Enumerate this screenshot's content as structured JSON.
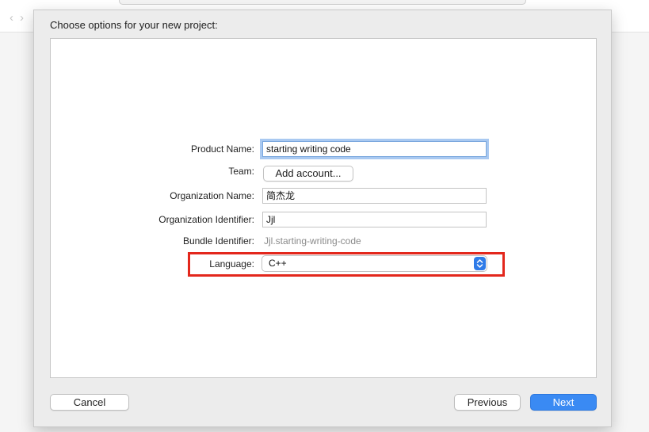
{
  "dialog": {
    "title": "Choose options for your new project:"
  },
  "form": {
    "product_name": {
      "label": "Product Name:",
      "value": "starting writing code"
    },
    "team": {
      "label": "Team:",
      "button_label": "Add account..."
    },
    "organization_name": {
      "label": "Organization Name:",
      "value": "简杰龙"
    },
    "organization_identifier": {
      "label": "Organization Identifier:",
      "value": "Jjl"
    },
    "bundle_identifier": {
      "label": "Bundle Identifier:",
      "value": "Jjl.starting-writing-code"
    },
    "language": {
      "label": "Language:",
      "selected": "C++"
    }
  },
  "footer": {
    "cancel_label": "Cancel",
    "previous_label": "Previous",
    "next_label": "Next"
  },
  "colors": {
    "accent": "#3a8af3",
    "highlight": "#e3271c",
    "focus_ring": "#a9c9f1"
  },
  "icons": {
    "back": "chevron-left-icon",
    "forward": "chevron-right-icon",
    "popup": "up-down-chevron-icon"
  }
}
